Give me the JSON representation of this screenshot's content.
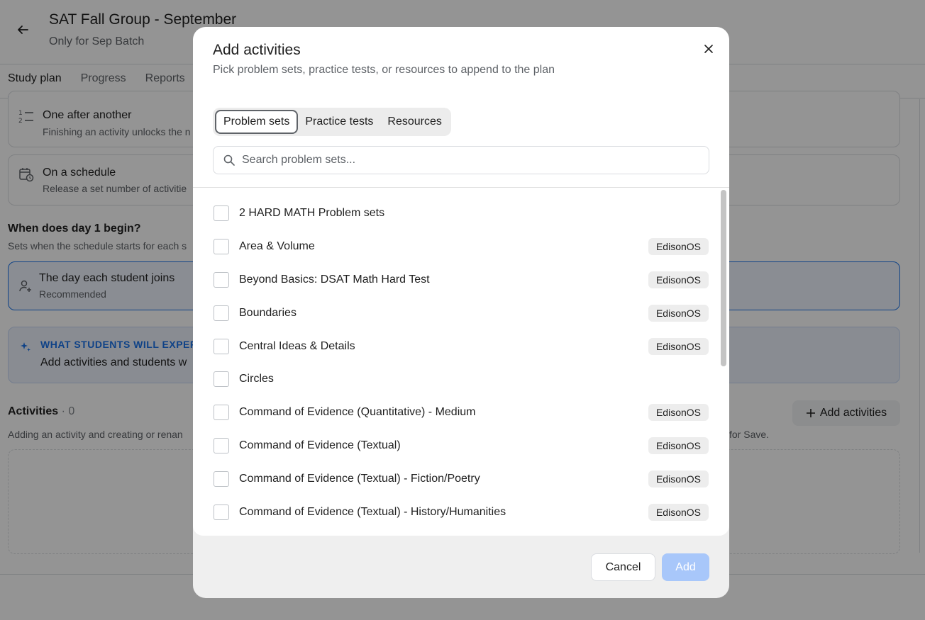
{
  "page": {
    "title": "SAT Fall Group - September",
    "subtitle": "Only for Sep Batch",
    "tabs": [
      {
        "label": "Study plan",
        "active": true
      },
      {
        "label": "Progress",
        "active": false
      },
      {
        "label": "Reports",
        "active": false
      }
    ],
    "cards": {
      "sequence": {
        "title": "One after another",
        "desc": "Finishing an activity unlocks the n"
      },
      "schedule": {
        "title": "On a schedule",
        "desc": "Release a set number of activitie"
      }
    },
    "day1": {
      "title": "When does day 1 begin?",
      "desc": "Sets when the schedule starts for each s",
      "option_title": "The day each student joins",
      "option_badge": "Recommended"
    },
    "info": {
      "label": "WHAT STUDENTS WILL EXPERI",
      "text": "Add activities and students w"
    },
    "activities": {
      "title": "Activities",
      "count": "· 0",
      "add_button": "Add activities",
      "note": "Adding an activity and creating or renan",
      "note_tail": "for Save."
    }
  },
  "dialog": {
    "title": "Add activities",
    "subtitle": "Pick problem sets, practice tests, or resources to append to the plan",
    "segments": [
      {
        "label": "Problem sets",
        "active": true
      },
      {
        "label": "Practice tests",
        "active": false
      },
      {
        "label": "Resources",
        "active": false
      }
    ],
    "search_placeholder": "Search problem sets...",
    "items": [
      {
        "label": "2 HARD MATH Problem sets",
        "badge": ""
      },
      {
        "label": "Area & Volume",
        "badge": "EdisonOS"
      },
      {
        "label": "Beyond Basics: DSAT Math Hard Test",
        "badge": "EdisonOS"
      },
      {
        "label": "Boundaries",
        "badge": "EdisonOS"
      },
      {
        "label": "Central Ideas & Details",
        "badge": "EdisonOS"
      },
      {
        "label": "Circles",
        "badge": ""
      },
      {
        "label": "Command of Evidence (Quantitative) - Medium",
        "badge": "EdisonOS"
      },
      {
        "label": "Command of Evidence (Textual)",
        "badge": "EdisonOS"
      },
      {
        "label": "Command of Evidence (Textual) - Fiction/Poetry",
        "badge": "EdisonOS"
      },
      {
        "label": "Command of Evidence (Textual) - History/Humanities",
        "badge": "EdisonOS"
      }
    ],
    "cancel_label": "Cancel",
    "add_label": "Add"
  },
  "colors": {
    "accent": "#1a73e8",
    "add_disabled": "#a8c7fa",
    "badge_bg": "#ededed"
  }
}
